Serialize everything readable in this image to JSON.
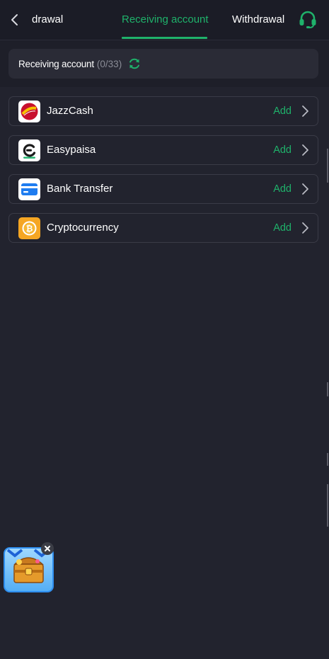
{
  "header": {
    "tabs": [
      {
        "label": "t withdrawal"
      },
      {
        "label": "Receiving account"
      },
      {
        "label": "Withdrawal"
      }
    ]
  },
  "section": {
    "title": "Receiving account",
    "count": "(0/33)"
  },
  "methods": [
    {
      "name": "JazzCash",
      "action": "Add",
      "icon": "jazzcash-logo"
    },
    {
      "name": "Easypaisa",
      "action": "Add",
      "icon": "easypaisa-logo"
    },
    {
      "name": "Bank Transfer",
      "action": "Add",
      "icon": "bank-card-icon"
    },
    {
      "name": "Cryptocurrency",
      "action": "Add",
      "icon": "crypto-coin-icon"
    }
  ],
  "colors": {
    "accent": "#1fb26b",
    "background": "#22232e",
    "card": "#2a2b36"
  },
  "icons": {
    "back": "chevron-left-icon",
    "support": "headset-icon",
    "refresh": "refresh-icon",
    "chest": "treasure-chest-icon",
    "close": "close-icon"
  }
}
